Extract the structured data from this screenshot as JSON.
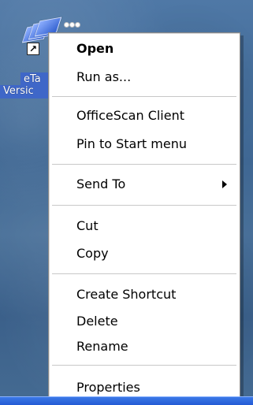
{
  "desktop": {
    "icon_name": "application-shortcut-icon",
    "label_line_1": "eTa",
    "label_line_2": "Versic"
  },
  "context_menu": {
    "items": [
      {
        "label": "Open",
        "bold": true
      },
      {
        "label": "Run as..."
      },
      {
        "label": "OfficeScan Client"
      },
      {
        "label": "Pin to Start menu"
      },
      {
        "label": "Send To",
        "has_submenu": true
      },
      {
        "label": "Cut"
      },
      {
        "label": "Copy"
      },
      {
        "label": "Create Shortcut"
      },
      {
        "label": "Delete"
      },
      {
        "label": "Rename"
      },
      {
        "label": "Properties"
      }
    ]
  }
}
